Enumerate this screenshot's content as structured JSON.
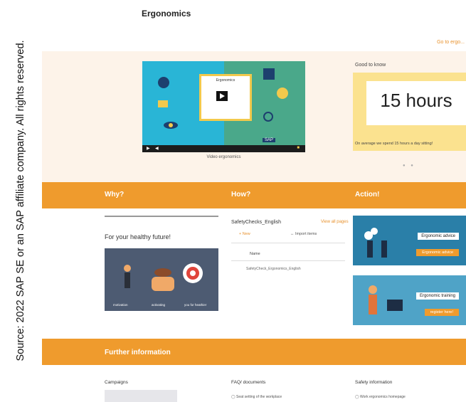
{
  "credit": "Source: 2022 SAP SE or an SAP affiliate company. All rights reserved.",
  "page": {
    "title": "Ergonomics",
    "goto_link": "Go to ergo..."
  },
  "video": {
    "card_title": "Ergonomics",
    "caption": "Video ergonomics",
    "brand": "SAP"
  },
  "good_to_know": {
    "title": "Good to know",
    "value": "15 hours",
    "text": "On average we spend 15 hours a day sitting!",
    "dots": "● ●"
  },
  "sections": {
    "why": "Why?",
    "how": "How?",
    "action": "Action!",
    "further": "Further information"
  },
  "why": {
    "tagline": "For your healthy future!",
    "illus_labels": [
      "motivation",
      "activating",
      "you for heathier"
    ]
  },
  "how": {
    "list_title": "SafetyChecks_English",
    "view_all": "View all pages",
    "new_label": "New",
    "import_label": "Import items",
    "column_header": "Name",
    "file_name": "SafetyCheck_Ergonomics_English"
  },
  "action": {
    "card1_label": "Ergonomic advice",
    "card1_button": "Ergonomic advice",
    "card2_label": "Ergonomic training",
    "card2_button": "register here!"
  },
  "further": {
    "campaigns": "Campaigns",
    "faq": "FAQ/ documents",
    "safety": "Safety information",
    "faq_item": "Seat setting of the workplace",
    "safety_item": "Work ergonomics homepage"
  },
  "colors": {
    "orange": "#ef9b2d",
    "hero_bg": "#fdf3e9",
    "video_blue": "#29b5d6",
    "video_green": "#4aa88a",
    "gtk_yellow": "#fbe28f",
    "action_blue": "#2a7fa8"
  }
}
